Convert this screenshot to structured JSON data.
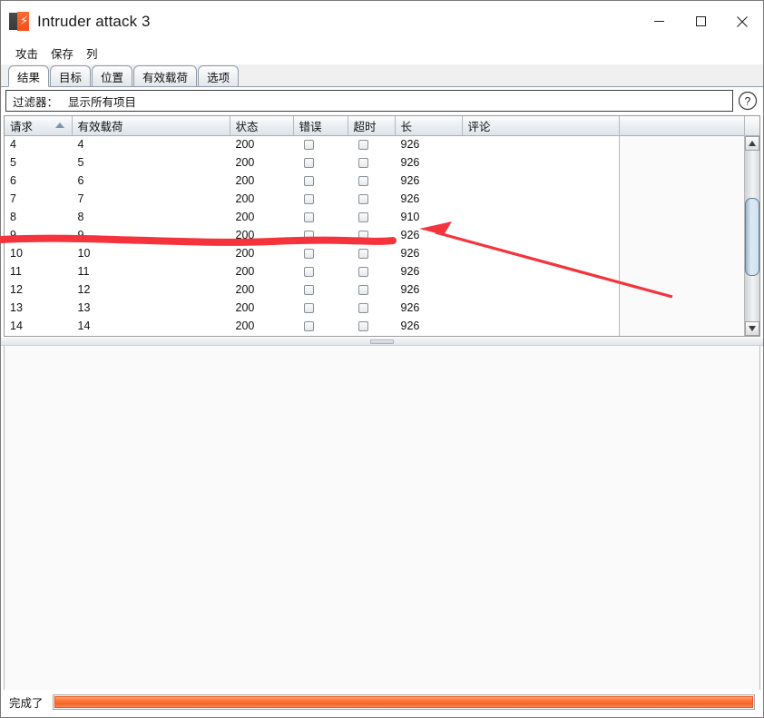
{
  "window": {
    "title": "Intruder attack 3",
    "icon": "burp-intruder-icon",
    "minimize_label": "—",
    "maximize_label": "□",
    "close_label": "✕"
  },
  "menu": {
    "items": [
      {
        "label": "攻击",
        "name": "menu-attack"
      },
      {
        "label": "保存",
        "name": "menu-save"
      },
      {
        "label": "列",
        "name": "menu-columns"
      }
    ]
  },
  "tabs": {
    "active_index": 0,
    "items": [
      {
        "label": "结果"
      },
      {
        "label": "目标"
      },
      {
        "label": "位置"
      },
      {
        "label": "有效载荷"
      },
      {
        "label": "选项"
      }
    ]
  },
  "filter": {
    "label": "过滤器：",
    "value": "显示所有项目",
    "help_icon": "question-mark-icon",
    "help_label": "?"
  },
  "table": {
    "columns": [
      {
        "label": "请求",
        "width": 74,
        "sorted": "asc"
      },
      {
        "label": "有效载荷",
        "width": 174,
        "sorted": ""
      },
      {
        "label": "状态",
        "width": 70,
        "sorted": ""
      },
      {
        "label": "错误",
        "width": 60,
        "sorted": ""
      },
      {
        "label": "超时",
        "width": 52,
        "sorted": ""
      },
      {
        "label": "长",
        "width": 74,
        "sorted": ""
      },
      {
        "label": "评论",
        "width": 173,
        "sorted": ""
      }
    ],
    "rows": [
      {
        "request": "4",
        "payload": "4",
        "status": "200",
        "error": false,
        "timeout": false,
        "length": "926",
        "comment": ""
      },
      {
        "request": "5",
        "payload": "5",
        "status": "200",
        "error": false,
        "timeout": false,
        "length": "926",
        "comment": ""
      },
      {
        "request": "6",
        "payload": "6",
        "status": "200",
        "error": false,
        "timeout": false,
        "length": "926",
        "comment": ""
      },
      {
        "request": "7",
        "payload": "7",
        "status": "200",
        "error": false,
        "timeout": false,
        "length": "926",
        "comment": ""
      },
      {
        "request": "8",
        "payload": "8",
        "status": "200",
        "error": false,
        "timeout": false,
        "length": "910",
        "comment": ""
      },
      {
        "request": "9",
        "payload": "9",
        "status": "200",
        "error": false,
        "timeout": false,
        "length": "926",
        "comment": ""
      },
      {
        "request": "10",
        "payload": "10",
        "status": "200",
        "error": false,
        "timeout": false,
        "length": "926",
        "comment": ""
      },
      {
        "request": "11",
        "payload": "11",
        "status": "200",
        "error": false,
        "timeout": false,
        "length": "926",
        "comment": ""
      },
      {
        "request": "12",
        "payload": "12",
        "status": "200",
        "error": false,
        "timeout": false,
        "length": "926",
        "comment": ""
      },
      {
        "request": "13",
        "payload": "13",
        "status": "200",
        "error": false,
        "timeout": false,
        "length": "926",
        "comment": ""
      },
      {
        "request": "14",
        "payload": "14",
        "status": "200",
        "error": false,
        "timeout": false,
        "length": "926",
        "comment": ""
      }
    ]
  },
  "scrollbar": {
    "up_icon": "triangle-up-icon",
    "down_icon": "triangle-down-icon",
    "thumb_name": "vertical-scroll-thumb"
  },
  "status": {
    "text": "完成了",
    "progress_percent": 100
  },
  "annotation": {
    "color": "#f4333c",
    "underline_target_row": "8",
    "arrow_target_value": "910"
  },
  "colors": {
    "accent_orange": "#f4622a",
    "annotation_red": "#f4333c",
    "tab_border": "#8f9aa8",
    "scroll_thumb": "#cfe2ef"
  }
}
